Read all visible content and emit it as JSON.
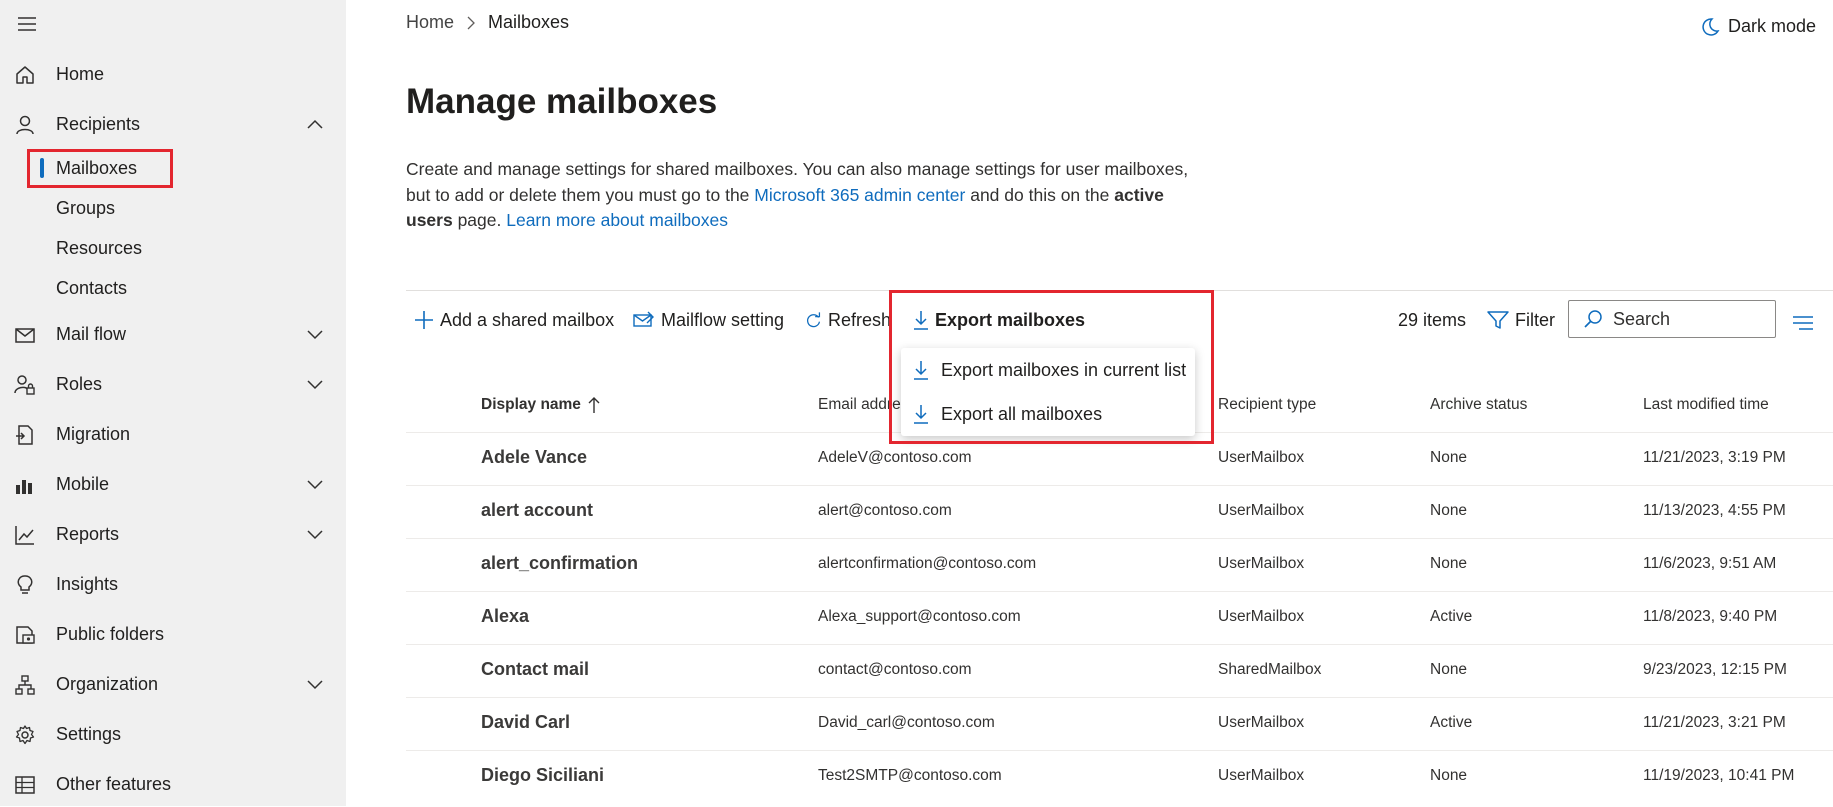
{
  "sidebar": {
    "items": [
      {
        "label": "Home",
        "icon": "home-icon"
      },
      {
        "label": "Recipients",
        "icon": "person-icon"
      },
      {
        "label": "Mail flow",
        "icon": "mail-icon"
      },
      {
        "label": "Roles",
        "icon": "roles-icon"
      },
      {
        "label": "Migration",
        "icon": "migration-icon"
      },
      {
        "label": "Mobile",
        "icon": "mobile-icon"
      },
      {
        "label": "Reports",
        "icon": "reports-icon"
      },
      {
        "label": "Insights",
        "icon": "lightbulb-icon"
      },
      {
        "label": "Public folders",
        "icon": "public-folders-icon"
      },
      {
        "label": "Organization",
        "icon": "organization-icon"
      },
      {
        "label": "Settings",
        "icon": "gear-icon"
      },
      {
        "label": "Other features",
        "icon": "grid-icon"
      }
    ],
    "subitems": [
      {
        "label": "Mailboxes"
      },
      {
        "label": "Groups"
      },
      {
        "label": "Resources"
      },
      {
        "label": "Contacts"
      }
    ]
  },
  "breadcrumb": {
    "home": "Home",
    "current": "Mailboxes"
  },
  "dark_mode_label": "Dark mode",
  "page_title": "Manage mailboxes",
  "description": {
    "part1": "Create and manage settings for shared mailboxes. You can also manage settings for user mailboxes, but to add or delete them you must go to the ",
    "link1": "Microsoft 365 admin center",
    "part2": " and do this on the ",
    "bold": "active users",
    "part3": " page. ",
    "link2": "Learn more about mailboxes"
  },
  "toolbar": {
    "add_shared": "Add a shared mailbox",
    "mailflow": "Mailflow setting",
    "refresh": "Refresh",
    "export": "Export mailboxes",
    "items_count": "29 items",
    "filter": "Filter",
    "search_placeholder": "Search"
  },
  "export_menu": {
    "current_list": "Export mailboxes in current list",
    "all": "Export all mailboxes"
  },
  "table": {
    "columns": {
      "display_name": "Display name",
      "email": "Email address",
      "recipient_type": "Recipient type",
      "archive_status": "Archive status",
      "last_modified": "Last modified time"
    },
    "rows": [
      {
        "name": "Adele Vance",
        "email": "AdeleV@contoso.com",
        "type": "UserMailbox",
        "archive": "None",
        "modified": "11/21/2023, 3:19 PM"
      },
      {
        "name": "alert account",
        "email": "alert@contoso.com",
        "type": "UserMailbox",
        "archive": "None",
        "modified": "11/13/2023, 4:55 PM"
      },
      {
        "name": "alert_confirmation",
        "email": "alertconfirmation@contoso.com",
        "type": "UserMailbox",
        "archive": "None",
        "modified": "11/6/2023, 9:51 AM"
      },
      {
        "name": "Alexa",
        "email": "Alexa_support@contoso.com",
        "type": "UserMailbox",
        "archive": "Active",
        "modified": "11/8/2023, 9:40 PM"
      },
      {
        "name": "Contact mail",
        "email": "contact@contoso.com",
        "type": "SharedMailbox",
        "archive": "None",
        "modified": "9/23/2023, 12:15 PM"
      },
      {
        "name": "David Carl",
        "email": "David_carl@contoso.com",
        "type": "UserMailbox",
        "archive": "Active",
        "modified": "11/21/2023, 3:21 PM"
      },
      {
        "name": "Diego Siciliani",
        "email": "Test2SMTP@contoso.com",
        "type": "UserMailbox",
        "archive": "None",
        "modified": "11/19/2023, 10:41 PM"
      }
    ]
  },
  "colors": {
    "accent": "#0f6cbd",
    "highlight": "#e3262f",
    "sidebar_bg": "#f0f0f0"
  }
}
